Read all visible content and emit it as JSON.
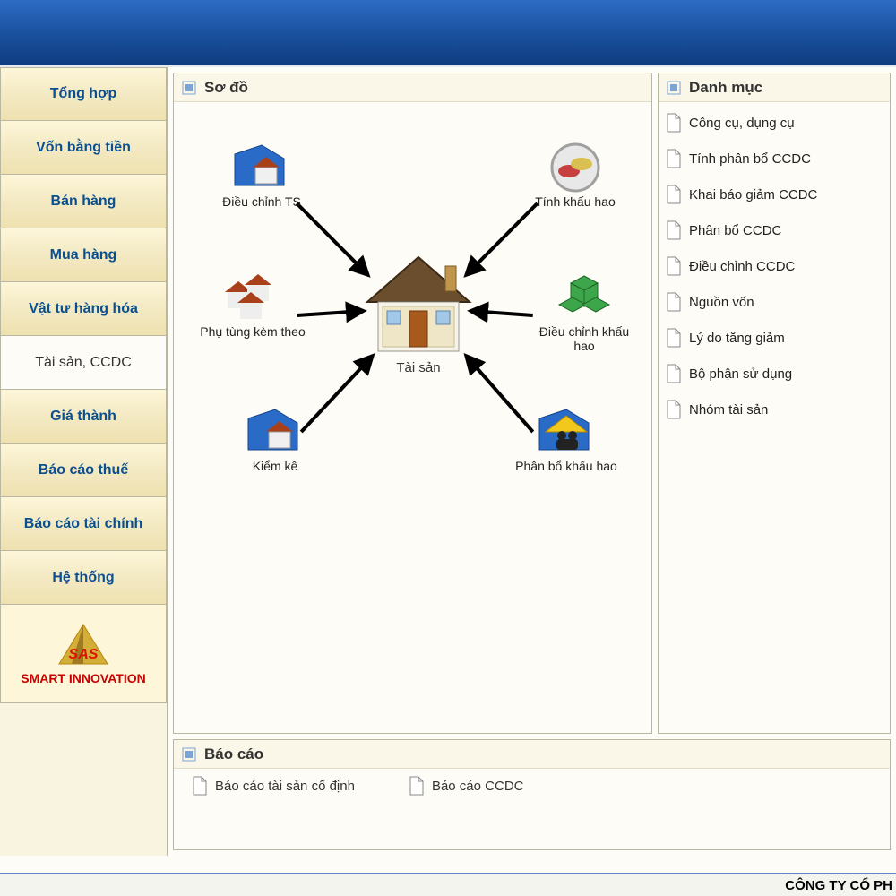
{
  "sidebar": {
    "items": [
      {
        "label": "Tổng hợp"
      },
      {
        "label": "Vốn bằng tiền"
      },
      {
        "label": "Bán hàng"
      },
      {
        "label": "Mua hàng"
      },
      {
        "label": "Vật tư hàng hóa"
      },
      {
        "label": "Tài sản, CCDC",
        "active": true
      },
      {
        "label": "Giá thành"
      },
      {
        "label": "Báo cáo thuế"
      },
      {
        "label": "Báo cáo tài chính"
      },
      {
        "label": "Hệ thống"
      }
    ],
    "logo_text": "SMART INNOVATION"
  },
  "panels": {
    "diagram_title": "Sơ đồ",
    "catalog_title": "Danh mục",
    "reports_title": "Báo cáo"
  },
  "diagram": {
    "center": {
      "label": "Tài sản"
    },
    "nodes": [
      {
        "key": "dieuchinh_ts",
        "label": "Điều chỉnh TS"
      },
      {
        "key": "tinhkhauhao",
        "label": "Tính khấu hao"
      },
      {
        "key": "phutung",
        "label": "Phụ tùng kèm theo"
      },
      {
        "key": "dieuchinh_khauhao",
        "label": "Điều chỉnh khấu hao"
      },
      {
        "key": "kiemke",
        "label": "Kiểm kê"
      },
      {
        "key": "phanbo_khauhao",
        "label": "Phân bổ khấu hao"
      }
    ]
  },
  "catalog": {
    "items": [
      {
        "label": "Công cụ, dụng cụ"
      },
      {
        "label": "Tính phân bổ CCDC"
      },
      {
        "label": "Khai báo giảm CCDC"
      },
      {
        "label": "Phân bổ CCDC"
      },
      {
        "label": "Điều chỉnh CCDC"
      },
      {
        "label": "Nguồn vốn"
      },
      {
        "label": "Lý do tăng giảm"
      },
      {
        "label": "Bộ phận sử dụng"
      },
      {
        "label": "Nhóm tài sản"
      }
    ]
  },
  "reports": {
    "items": [
      {
        "label": "Báo cáo tài sản cố định"
      },
      {
        "label": "Báo cáo CCDC"
      }
    ]
  },
  "footer": {
    "company_fragment": "CÔNG TY CỔ PH"
  }
}
